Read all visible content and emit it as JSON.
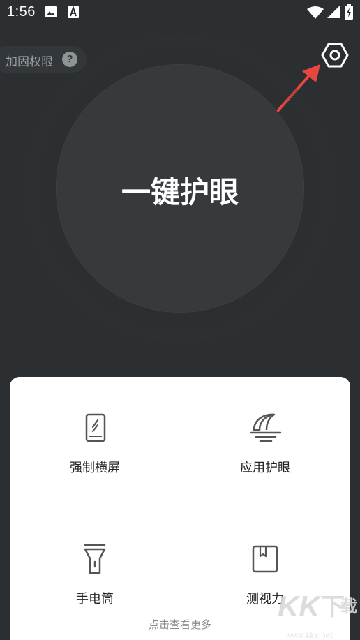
{
  "status_bar": {
    "time": "1:56",
    "icons": [
      "image-icon",
      "a-icon",
      "wifi-icon",
      "signal-icon",
      "battery-charging-icon"
    ]
  },
  "header": {
    "boost_label": "加固权限",
    "help_symbol": "?",
    "settings_icon": "hexagon-settings-icon"
  },
  "main": {
    "eye_protect_label": "一键护眼"
  },
  "features": [
    {
      "label": "强制横屏",
      "icon": "rotate-phone-icon"
    },
    {
      "label": "应用护眼",
      "icon": "moon-icon"
    },
    {
      "label": "手电筒",
      "icon": "flashlight-icon"
    },
    {
      "label": "测视力",
      "icon": "book-icon"
    }
  ],
  "more_link": "点击查看更多",
  "watermark": {
    "text": "www.kkx.net"
  },
  "colors": {
    "background": "#2b2f32",
    "circle": "#363a3d",
    "panel": "#ffffff",
    "arrow": "#e8473f"
  }
}
